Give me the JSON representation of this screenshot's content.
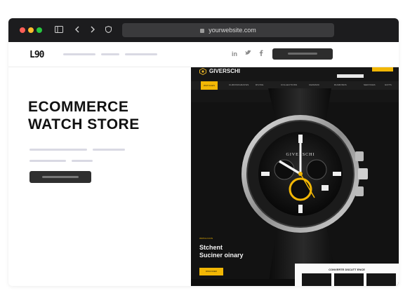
{
  "browser": {
    "url": "yourwebsite.com",
    "icons": [
      "sidebar-icon",
      "back-icon",
      "forward-icon",
      "shield-icon",
      "lock-icon"
    ]
  },
  "site_nav": {
    "logo_text": "L90",
    "social": [
      "in",
      "twitter-icon",
      "facebook-icon"
    ]
  },
  "hero": {
    "title_line1": "ECOMMERCE",
    "title_line2": "WATCH STORE"
  },
  "screenshot": {
    "brand": "GIVERSCHI",
    "menu": [
      "WATCHES",
      "CHRONOGRAPHS",
      "DIVING",
      "COLLECTIONS",
      "CERAMIC",
      "DIAMONDS",
      "SERVICES",
      "GIFTS"
    ],
    "tag": "WATCH ICON",
    "title_line1": "Stchent",
    "title_line2": "Suciner oinary",
    "button": "DISCOVER",
    "panel_title": "CONVERTE DSCUTT ENCE",
    "dial_brand": "GIVERSCHI"
  },
  "colors": {
    "accent": "#f2b705",
    "dark": "#121212",
    "bezel": "#2a2a2a"
  }
}
